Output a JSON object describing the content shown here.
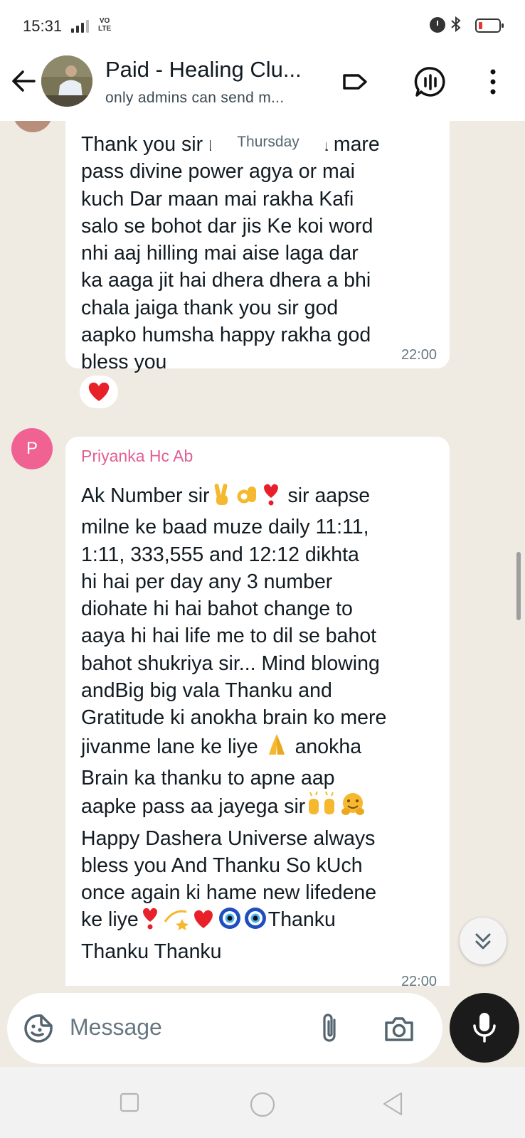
{
  "status_bar": {
    "time": "15:31",
    "network_line1": "VO",
    "network_line2": "LTE"
  },
  "header": {
    "title": "Paid - Healing Clu...",
    "subtitle": "only admins can send m...",
    "icons": [
      "back-arrow-icon",
      "label-icon",
      "voice-chat-icon",
      "more-vert-icon"
    ]
  },
  "chat": {
    "date_separator": "Thursday",
    "messages": [
      {
        "lines": [
          "Thank you sir mai aisa laga mare",
          "pass divine power agya or mai",
          "kuch Dar maan mai rakha Kafi",
          "salo se bohot dar jis Ke koi word",
          "nhi aaj hilling mai aise laga dar",
          "ka aaga jit hai dhera dhera a bhi",
          "chala jaiga thank you sir god",
          "aapko humsha happy rakha god",
          "bless you"
        ],
        "time": "22:00",
        "reaction": "heart"
      },
      {
        "sender": "Priyanka Hc Ab",
        "avatar_letter": "P",
        "avatar_color": "#f06292",
        "lines": [
          "Ak Number sir",
          "milne ke baad muze daily 11:11,",
          "1:11, 333,555 and 12:12 dikhta",
          "hi hai per day any 3 number",
          "diohate hi hai bahot change to",
          "aaya hi hai life me to dil se bahot",
          "bahot shukriya sir... Mind blowing",
          "andBig big vala Thanku and",
          "Gratitude ki anokha brain ko mere",
          "jivanme lane ke liye",
          "Brain ka thanku to apne aap",
          "aapke pass aa jayega sir",
          "Happy Dashera Universe always",
          "bless you And Thanku So kUch",
          "once again ki hame new lifedene",
          "ke liye",
          "Thanku Thanku"
        ],
        "inline": {
          "line1_after": "sir aapse",
          "line10_after": "anokha",
          "line16_after": "Thanku"
        },
        "time": "22:00"
      }
    ]
  },
  "input": {
    "placeholder": "Message"
  },
  "colors": {
    "chat_bg": "#efeae2",
    "bubble": "#ffffff",
    "sender_name": "#e05e94",
    "mic_button": "#1b1b1b"
  }
}
